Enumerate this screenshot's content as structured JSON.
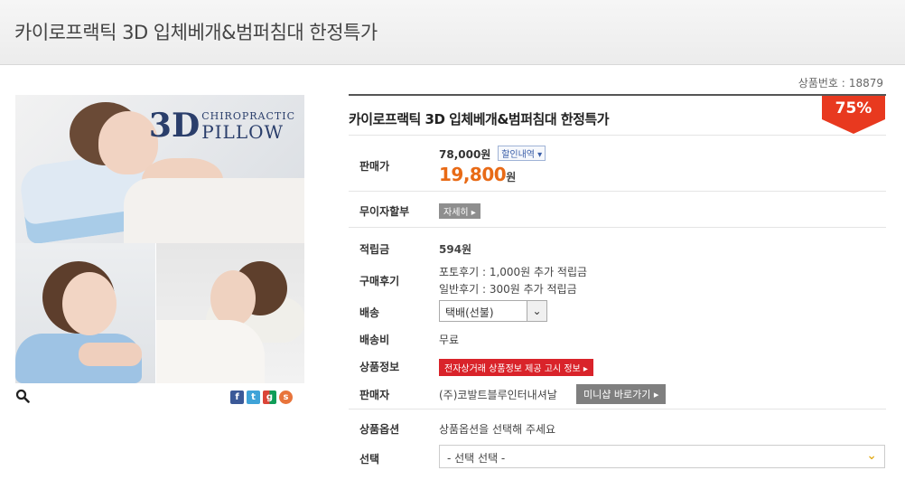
{
  "page_title": "카이로프랙틱 3D 입체베개&범퍼침대 한정특가",
  "product_number": {
    "label": "상품번호 :",
    "value": "18879"
  },
  "image": {
    "logo_mark": "3D",
    "logo_line1": "CHIROPRACTIC",
    "logo_line2": "PILLOW"
  },
  "share_icons": [
    "facebook-icon",
    "twitter-icon",
    "googleplus-icon",
    "kakaostory-icon"
  ],
  "product_name": "카이로프랙틱 3D 입체베개&범퍼침대 한정특가",
  "discount_badge": "75%",
  "price": {
    "label": "판매가",
    "original": "78,000원",
    "discount_detail_btn": "할인내역",
    "sale_value": "19,800",
    "sale_unit": "원"
  },
  "installment": {
    "label": "무이자할부",
    "button": "자세히"
  },
  "points": {
    "label": "적립금",
    "value": "594원"
  },
  "review": {
    "label": "구매후기",
    "line1": "포토후기 : 1,000원 추가 적립금",
    "line2": "일반후기 : 300원 추가 적립금"
  },
  "shipping": {
    "label": "배송",
    "selected": "택배(선불)"
  },
  "shipping_fee": {
    "label": "배송비",
    "value": "무료"
  },
  "product_info": {
    "label": "상품정보",
    "button": "전자상거래 상품정보 제공 고시 정보"
  },
  "seller": {
    "label": "판매자",
    "name": "(주)코발트블루인터내셔날",
    "button": "미니샵 바로가기"
  },
  "option": {
    "label": "상품옵션",
    "value": "상품옵션을 선택해 주세요"
  },
  "choice": {
    "label": "선택",
    "selected": "- 선택 선택 -"
  },
  "colors": {
    "accent_orange": "#e86a16",
    "badge_red": "#e8391f",
    "info_red": "#d9232a"
  }
}
